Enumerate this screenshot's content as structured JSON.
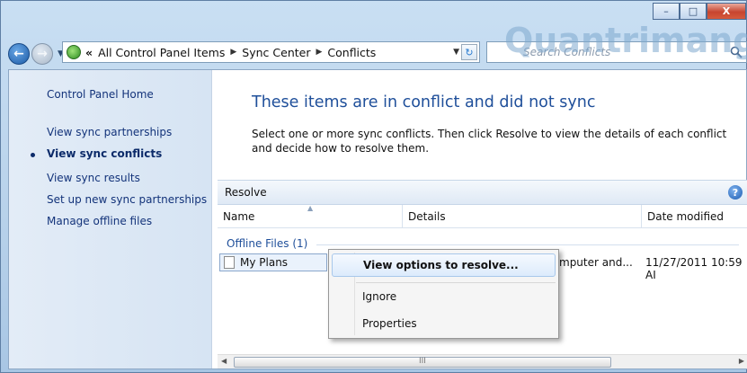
{
  "window": {
    "minimize": "–",
    "maximize": "□",
    "close": "X"
  },
  "nav": {
    "back_icon": "back-arrow-icon",
    "forward_icon": "forward-arrow-icon",
    "breadcrumb": [
      "All Control Panel Items",
      "Sync Center",
      "Conflicts"
    ],
    "breadcrumb_prefix": "«",
    "search_placeholder": "Search Conflicts"
  },
  "watermark": "Quantrimang",
  "sidebar": {
    "items": [
      {
        "label": "Control Panel Home"
      },
      {
        "label": "View sync partnerships"
      },
      {
        "label": "View sync conflicts"
      },
      {
        "label": "View sync results"
      },
      {
        "label": "Set up new sync partnerships"
      },
      {
        "label": "Manage offline files"
      }
    ]
  },
  "main": {
    "heading": "These items are in conflict and did not sync",
    "description": "Select one or more sync conflicts. Then click Resolve to view the details of each conflict and decide how to resolve them."
  },
  "toolbar": {
    "resolve_label": "Resolve",
    "help": "?"
  },
  "table": {
    "columns": [
      "Name",
      "Details",
      "Date modified"
    ],
    "group": "Offline Files (1)",
    "rows": [
      {
        "name": "My Plans",
        "details": "mputer and...",
        "date": "11/27/2011 10:59 AI"
      }
    ],
    "scroll_grip": "III"
  },
  "context_menu": {
    "items": [
      "View options to resolve...",
      "Ignore",
      "Properties"
    ]
  }
}
